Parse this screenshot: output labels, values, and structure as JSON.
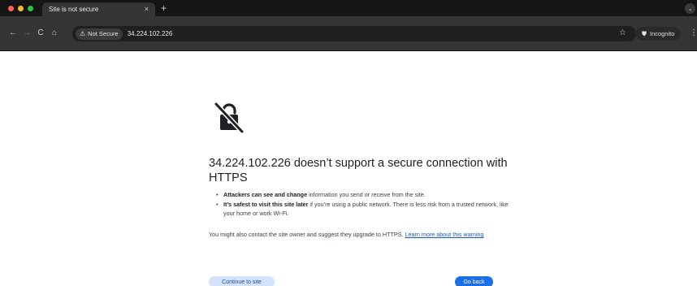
{
  "colors": {
    "chrome_bg": "#151515",
    "toolbar_bg": "#353535",
    "link": "#1a57d6",
    "primary_button": "#1a6ee8",
    "secondary_button": "#d3e3fd"
  },
  "tab": {
    "title": "Site is not secure",
    "close_icon": "×",
    "new_tab_icon": "+"
  },
  "toolbar": {
    "back_icon": "←",
    "forward_icon": "→",
    "reload_icon": "C",
    "home_icon": "⌂",
    "security_chip_icon": "⚠",
    "security_chip_label": "Not Secure",
    "url": "34.224.102.226",
    "bookmark_icon": "☆",
    "incognito_icon": "⛊",
    "incognito_label": "Incognito",
    "menu_icon": "⋮"
  },
  "page": {
    "headline": "34.224.102.226 doesn’t support a secure connection with HTTPS",
    "bullets": [
      {
        "bold": "Attackers can see and change",
        "text": " information you send or receive from the site."
      },
      {
        "bold": "It’s safest to visit this site later",
        "text": " if you’re using a public network. There is less risk from a trusted network, like your home or work Wi-Fi."
      }
    ],
    "contact_text": "You might also contact the site owner and suggest they upgrade to HTTPS. ",
    "learn_more_link": "Learn more about this warning",
    "continue_button": "Continue to site",
    "go_back_button": "Go back"
  }
}
